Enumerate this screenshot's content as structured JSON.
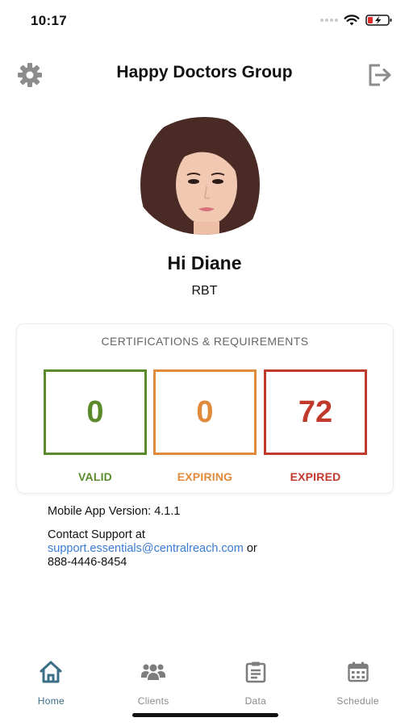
{
  "status_bar": {
    "time": "10:17"
  },
  "header": {
    "title": "Happy Doctors Group",
    "settings_icon": "gear-icon",
    "logout_icon": "logout-icon"
  },
  "profile": {
    "greeting": "Hi Diane",
    "role": "RBT",
    "avatar_alt": "Profile photo"
  },
  "certifications": {
    "title": "CERTIFICATIONS & REQUIREMENTS",
    "items": [
      {
        "label": "VALID",
        "count": "0",
        "color": "#5b8a2b"
      },
      {
        "label": "EXPIRING",
        "count": "0",
        "color": "#e08a3c"
      },
      {
        "label": "EXPIRED",
        "count": "72",
        "color": "#c0392b"
      }
    ]
  },
  "info": {
    "version": "Mobile App Version: 4.1.1",
    "contact_prefix": "Contact Support at",
    "support_email": "support.essentials@centralreach.com",
    "or_text": "or",
    "phone": "888-4446-8454"
  },
  "tabbar": {
    "tabs": [
      {
        "label": "Home",
        "icon": "home-icon",
        "active": true
      },
      {
        "label": "Clients",
        "icon": "clients-icon",
        "active": false
      },
      {
        "label": "Data",
        "icon": "clipboard-icon",
        "active": false
      },
      {
        "label": "Schedule",
        "icon": "calendar-icon",
        "active": false
      }
    ]
  },
  "colors": {
    "link": "#3a7bd5",
    "active_tab": "#3b6f86",
    "inactive_tab": "#8a8a8a"
  }
}
